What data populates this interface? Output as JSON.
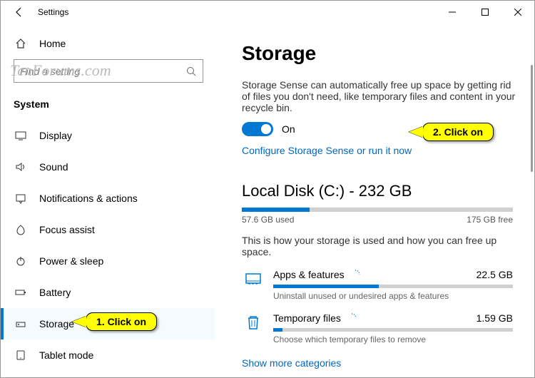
{
  "window": {
    "title": "Settings"
  },
  "watermark": "TenForums.com",
  "sidebar": {
    "home": "Home",
    "search_placeholder": "Find a setting",
    "section": "System",
    "items": [
      {
        "label": "Display"
      },
      {
        "label": "Sound"
      },
      {
        "label": "Notifications & actions"
      },
      {
        "label": "Focus assist"
      },
      {
        "label": "Power & sleep"
      },
      {
        "label": "Battery"
      },
      {
        "label": "Storage"
      },
      {
        "label": "Tablet mode"
      }
    ]
  },
  "main": {
    "heading": "Storage",
    "sense_desc": "Storage Sense can automatically free up space by getting rid of files you don't need, like temporary files and content in your recycle bin.",
    "toggle_state": "On",
    "configure_link": "Configure Storage Sense or run it now",
    "disk": {
      "title": "Local Disk (C:) - 232 GB",
      "used_label": "57.6 GB used",
      "free_label": "175 GB free",
      "fill_pct": 25
    },
    "usage_desc": "This is how your storage is used and how you can free up space.",
    "categories": [
      {
        "name": "Apps & features",
        "size": "22.5 GB",
        "hint": "Uninstall unused or undesired apps & features",
        "pct": 44
      },
      {
        "name": "Temporary files",
        "size": "1.59 GB",
        "hint": "Choose which temporary files to remove",
        "pct": 4
      }
    ],
    "show_more": "Show more categories"
  },
  "callouts": {
    "one": "1. Click on",
    "two": "2. Click on"
  }
}
